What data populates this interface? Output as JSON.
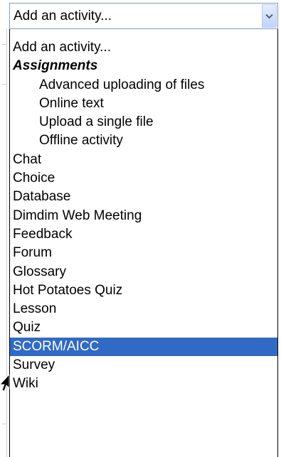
{
  "select": {
    "value": "Add an activity...",
    "button_icon": "chevron-down-icon"
  },
  "options": [
    {
      "label": "Add an activity...",
      "kind": "option",
      "indented": false
    },
    {
      "label": "Assignments",
      "kind": "group",
      "indented": false
    },
    {
      "label": "Advanced uploading of files",
      "kind": "option",
      "indented": true
    },
    {
      "label": "Online text",
      "kind": "option",
      "indented": true
    },
    {
      "label": "Upload a single file",
      "kind": "option",
      "indented": true
    },
    {
      "label": "Offline activity",
      "kind": "option",
      "indented": true
    },
    {
      "label": "Chat",
      "kind": "option",
      "indented": false
    },
    {
      "label": "Choice",
      "kind": "option",
      "indented": false
    },
    {
      "label": "Database",
      "kind": "option",
      "indented": false
    },
    {
      "label": "Dimdim Web Meeting",
      "kind": "option",
      "indented": false
    },
    {
      "label": "Feedback",
      "kind": "option",
      "indented": false
    },
    {
      "label": "Forum",
      "kind": "option",
      "indented": false
    },
    {
      "label": "Glossary",
      "kind": "option",
      "indented": false
    },
    {
      "label": "Hot Potatoes Quiz",
      "kind": "option",
      "indented": false
    },
    {
      "label": "Lesson",
      "kind": "option",
      "indented": false
    },
    {
      "label": "Quiz",
      "kind": "option",
      "indented": false
    },
    {
      "label": "SCORM/AICC",
      "kind": "option",
      "indented": false,
      "highlighted": true
    },
    {
      "label": "Survey",
      "kind": "option",
      "indented": false
    },
    {
      "label": "Wiki",
      "kind": "option",
      "indented": false
    }
  ],
  "colors": {
    "highlight": "#316ac5",
    "highlight_text": "#ffffff",
    "border": "#7f9db9"
  },
  "pointer_icon": "mouse-pointer-icon"
}
